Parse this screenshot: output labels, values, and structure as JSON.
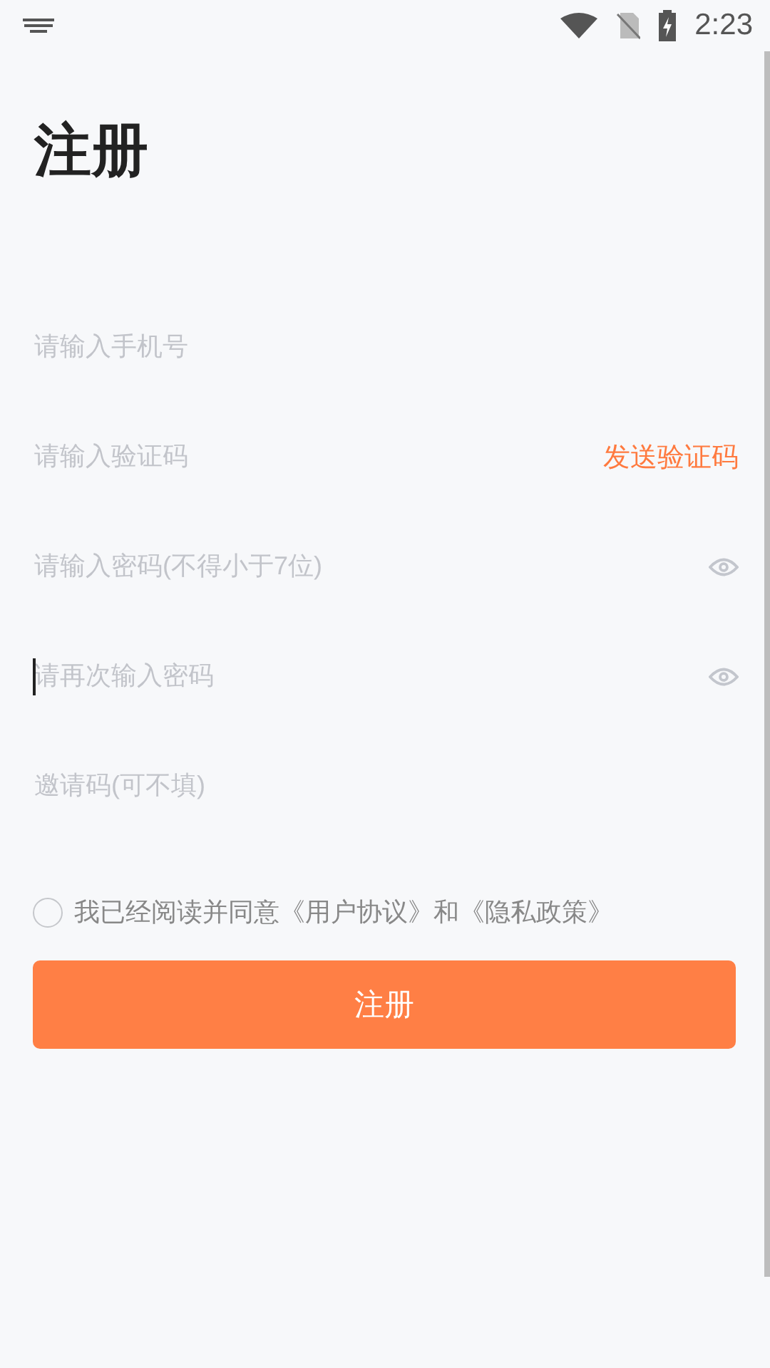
{
  "status_bar": {
    "time": "2:23"
  },
  "title": "注册",
  "fields": [
    {
      "kind": "plain",
      "placeholder": "请输入手机号",
      "focused": false
    },
    {
      "kind": "code",
      "placeholder": "请输入验证码",
      "focused": false,
      "action": "发送验证码"
    },
    {
      "kind": "password",
      "placeholder": "请输入密码(不得小于7位)",
      "focused": false
    },
    {
      "kind": "password",
      "placeholder": "请再次输入密码",
      "focused": true
    },
    {
      "kind": "plain",
      "placeholder": "邀请码(可不填)",
      "focused": false
    }
  ],
  "agreement": {
    "checked": false,
    "text": "我已经阅读并同意《用户协议》和《隐私政策》"
  },
  "submit_button": "注册"
}
